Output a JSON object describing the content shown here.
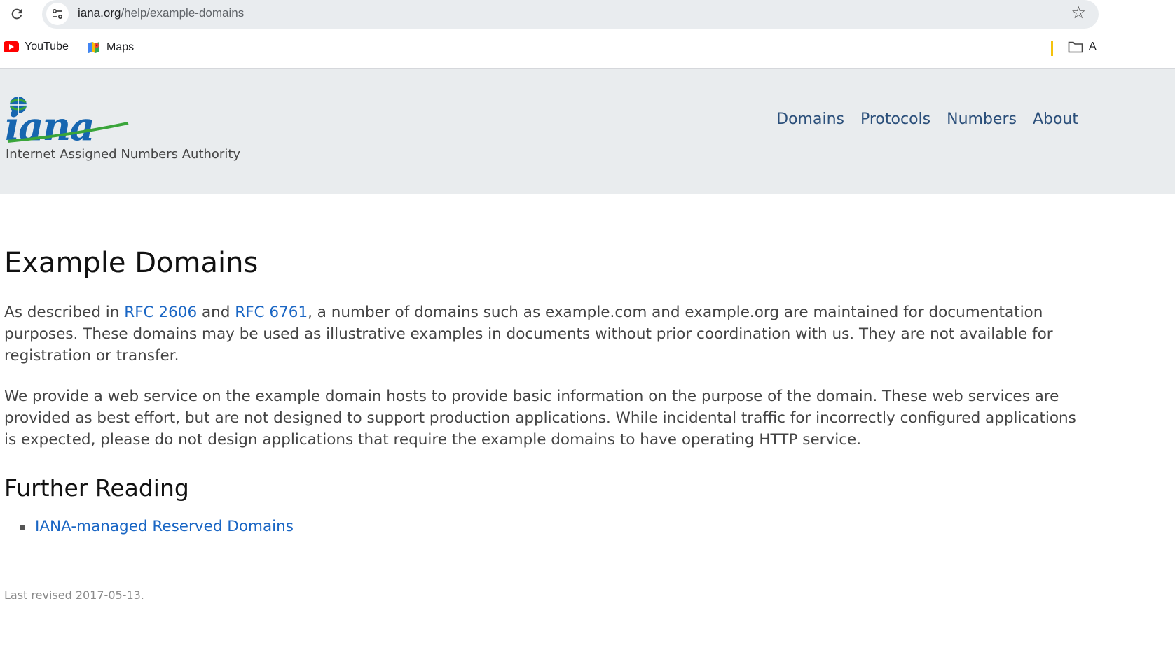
{
  "browser": {
    "url_host": "iana.org",
    "url_path": "/help/example-domains",
    "bookmarks": [
      {
        "label": "YouTube",
        "icon": "youtube-icon"
      },
      {
        "label": "Maps",
        "icon": "maps-icon"
      }
    ],
    "folder_label": "A"
  },
  "header": {
    "logo_text": "iana",
    "tagline": "Internet Assigned Numbers Authority",
    "nav": [
      "Domains",
      "Protocols",
      "Numbers",
      "About"
    ]
  },
  "main": {
    "title": "Example Domains",
    "p1": {
      "t1": "As described in ",
      "link1": "RFC 2606",
      "t2": " and ",
      "link2": "RFC 6761",
      "t3": ", a number of domains such as example.com and example.org are maintained for documentation purposes. These domains may be used as illustrative examples in documents without prior coordination with us. They are not available for registration or transfer."
    },
    "p2": "We provide a web service on the example domain hosts to provide basic information on the purpose of the domain. These web services are provided as best effort, but are not designed to support production applications. While incidental traffic for incorrectly configured applications is expected, please do not design applications that require the example domains to have operating HTTP service.",
    "further_heading": "Further Reading",
    "further_links": [
      "IANA-managed Reserved Domains"
    ]
  },
  "footer": {
    "revised": "Last revised 2017-05-13."
  },
  "colors": {
    "link": "#1a66c4",
    "nav": "#2b4f7a",
    "header_bg": "#e9ecee",
    "logo_blue": "#1766b0",
    "logo_green": "#3aa53a"
  }
}
